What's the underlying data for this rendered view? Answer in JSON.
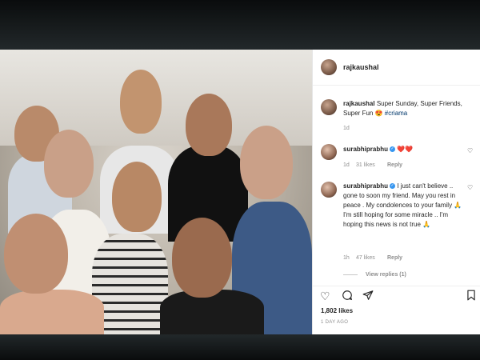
{
  "post": {
    "username": "rajkaushal",
    "caption_user": "rajkaushal",
    "caption_text": "Super Sunday, Super Friends, Super Fun",
    "caption_emoji": "😍",
    "caption_hashtag": "#criama",
    "caption_age": "1d"
  },
  "comments": [
    {
      "user": "surabhiprabhu",
      "text": "❤️❤️",
      "age": "1d",
      "likes": "31 likes",
      "reply": "Reply"
    },
    {
      "user": "surabhiprabhu",
      "text": "I just can't believe .. gone to soon my friend. May you rest in peace . My condolences to your family 🙏 I'm still hoping for some miracle .. I'm hoping this news is not true 🙏",
      "age": "1h",
      "likes": "47 likes",
      "reply": "Reply",
      "view_replies": "View replies (1)"
    }
  ],
  "footer": {
    "likes": "1,802 likes",
    "posted": "1 DAY AGO"
  },
  "icons": {
    "like": "heart-icon",
    "comment": "comment-icon",
    "share": "send-icon",
    "save": "bookmark-icon",
    "more": "more-icon"
  },
  "colors": {
    "link": "#00376b",
    "verified": "#3897f0",
    "meta": "#8e8e8e",
    "text": "#262626"
  }
}
